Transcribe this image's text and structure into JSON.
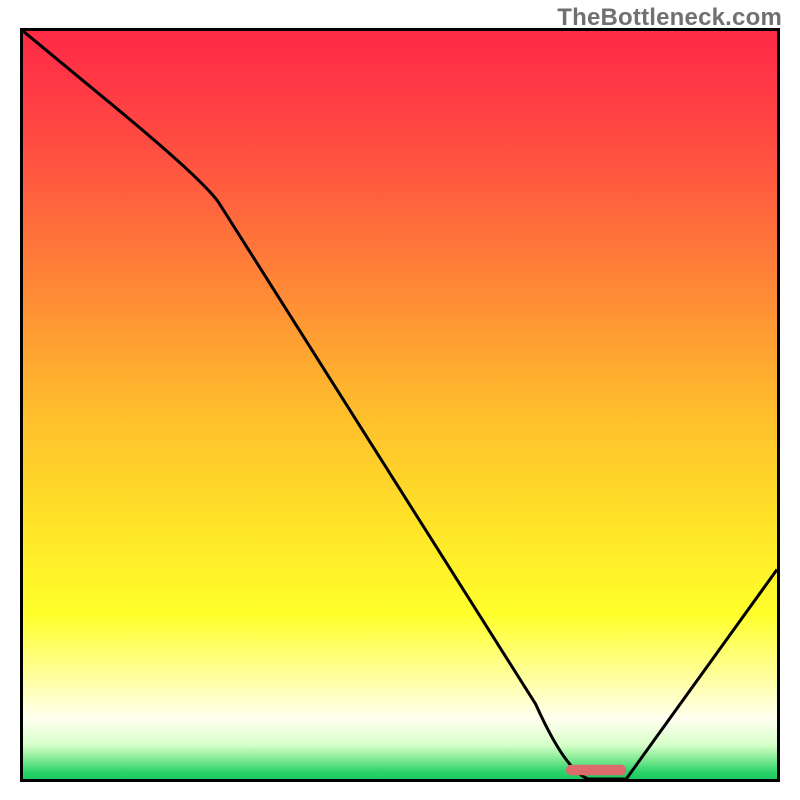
{
  "watermark": "TheBottleneck.com",
  "chart_data": {
    "type": "line",
    "title": "",
    "xlabel": "",
    "ylabel": "",
    "xlim": [
      0,
      100
    ],
    "ylim": [
      0,
      100
    ],
    "grid": false,
    "legend": null,
    "series": [
      {
        "name": "bottleneck-curve",
        "x": [
          0,
          12,
          25,
          40,
          55,
          68,
          72,
          75,
          80,
          100
        ],
        "y": [
          100,
          90,
          78,
          55,
          32,
          10,
          2,
          0,
          0,
          28
        ]
      }
    ],
    "marker": {
      "x_start": 72,
      "x_end": 80,
      "y": 0,
      "color": "#dd6b6b"
    },
    "gradient_stops": [
      {
        "offset": 0.0,
        "color": "#ff2a46"
      },
      {
        "offset": 0.08,
        "color": "#ff3a45"
      },
      {
        "offset": 0.2,
        "color": "#ff5a3f"
      },
      {
        "offset": 0.35,
        "color": "#ff8a36"
      },
      {
        "offset": 0.5,
        "color": "#ffbb2d"
      },
      {
        "offset": 0.65,
        "color": "#ffe128"
      },
      {
        "offset": 0.78,
        "color": "#ffff2b"
      },
      {
        "offset": 0.87,
        "color": "#ffffa8"
      },
      {
        "offset": 0.92,
        "color": "#fffff0"
      },
      {
        "offset": 0.955,
        "color": "#d6ffc8"
      },
      {
        "offset": 0.975,
        "color": "#79e88f"
      },
      {
        "offset": 0.99,
        "color": "#2fd36c"
      },
      {
        "offset": 1.0,
        "color": "#18c95f"
      }
    ]
  }
}
